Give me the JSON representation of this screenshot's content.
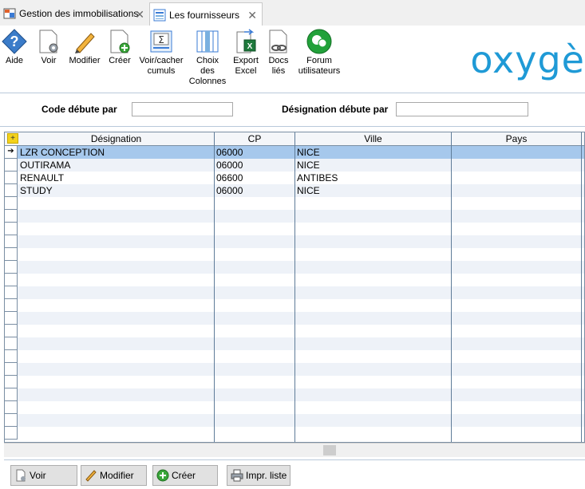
{
  "tabs": [
    {
      "label": "Gestion des immobilisations",
      "active": false
    },
    {
      "label": "Les fournisseurs",
      "active": true
    }
  ],
  "toolbar": {
    "aide": "Aide",
    "voir": "Voir",
    "modifier": "Modifier",
    "creer": "Créer",
    "cumuls": [
      "Voir/cacher",
      "cumuls"
    ],
    "colonnes": [
      "Choix",
      "des",
      "Colonnes"
    ],
    "export": [
      "Export",
      "Excel"
    ],
    "docs": [
      "Docs",
      "liés"
    ],
    "forum": [
      "Forum",
      "utilisateurs"
    ]
  },
  "logo": "oxygè",
  "filter": {
    "code_label": "Code débute par",
    "code_value": "",
    "designation_label": "Désignation débute par",
    "designation_value": ""
  },
  "grid": {
    "columns": [
      "Désignation",
      "CP",
      "Ville",
      "Pays"
    ],
    "rows": [
      {
        "designation": "LZR CONCEPTION",
        "cp": "06000",
        "ville": "NICE",
        "pays": ""
      },
      {
        "designation": "OUTIRAMA",
        "cp": "06000",
        "ville": "NICE",
        "pays": ""
      },
      {
        "designation": "RENAULT",
        "cp": "06600",
        "ville": "ANTIBES",
        "pays": ""
      },
      {
        "designation": "STUDY",
        "cp": "06000",
        "ville": "NICE",
        "pays": ""
      }
    ],
    "selected_row": 0,
    "row_indicator": "➔"
  },
  "buttons": {
    "voir": "Voir",
    "modifier": "Modifier",
    "creer": "Créer",
    "imprimer": "Impr. liste"
  },
  "colors": {
    "selection": "#a6c8ec",
    "alt_row": "#eef2f8",
    "logo": "#1f9ad6"
  }
}
